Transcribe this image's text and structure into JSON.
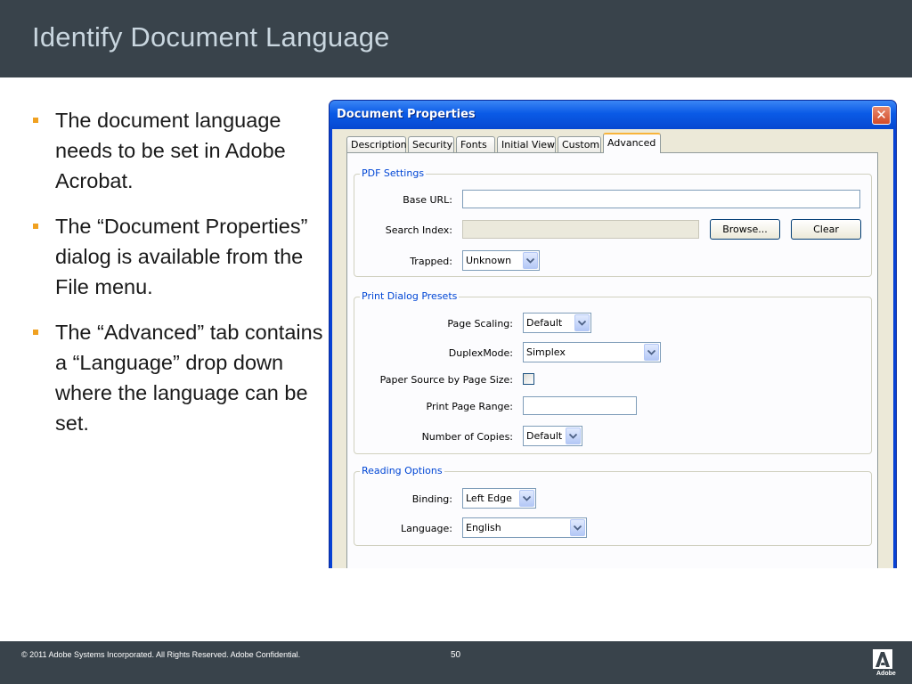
{
  "slide": {
    "title": "Identify Document Language",
    "bullets": [
      "The document language needs to be set in Adobe Acrobat.",
      "The “Document Properties” dialog is available from the File menu.",
      "The “Advanced” tab contains a “Language” drop down where the language can be set."
    ],
    "bullet_color": "#f0a121"
  },
  "dialog": {
    "title": "Document Properties",
    "close_symbol": "✕",
    "tabs": [
      {
        "label": "Description"
      },
      {
        "label": "Security"
      },
      {
        "label": "Fonts"
      },
      {
        "label": "Initial View"
      },
      {
        "label": "Custom"
      },
      {
        "label": "Advanced",
        "active": true
      }
    ],
    "pdf_settings": {
      "legend": "PDF Settings",
      "base_url_label": "Base URL:",
      "base_url_value": "",
      "search_index_label": "Search Index:",
      "search_index_value": "",
      "browse_button": "Browse...",
      "clear_button": "Clear",
      "trapped_label": "Trapped:",
      "trapped_value": "Unknown"
    },
    "print_presets": {
      "legend": "Print Dialog Presets",
      "page_scaling_label": "Page Scaling:",
      "page_scaling_value": "Default",
      "duplex_label": "DuplexMode:",
      "duplex_value": "Simplex",
      "paper_source_label": "Paper Source by Page Size:",
      "paper_source_checked": false,
      "print_range_label": "Print Page Range:",
      "print_range_value": "",
      "copies_label": "Number of Copies:",
      "copies_value": "Default"
    },
    "reading_options": {
      "legend": "Reading Options",
      "binding_label": "Binding:",
      "binding_value": "Left Edge",
      "language_label": "Language:",
      "language_value": "English"
    }
  },
  "footer": {
    "copyright": "© 2011 Adobe Systems Incorporated.  All Rights Reserved.  Adobe Confidential.",
    "page_number": "50",
    "logo_text": "Adobe",
    "logo_icon": "adobe-logo-icon"
  },
  "colors": {
    "header_bg": "#39434b",
    "title_color": "#c9d6df",
    "dialog_accent": "#0046d5"
  }
}
